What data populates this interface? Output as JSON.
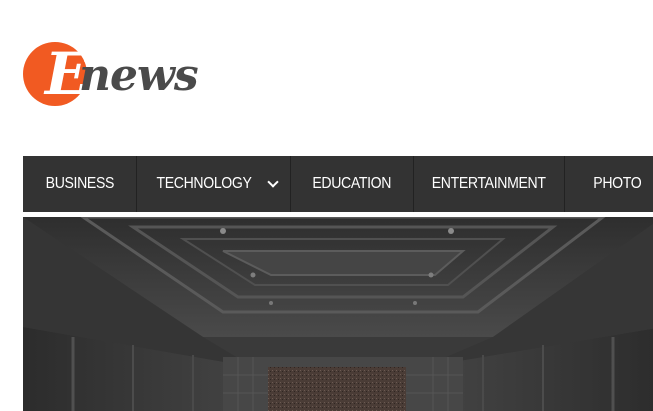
{
  "site": {
    "logo_initial": "E",
    "logo_rest": "news",
    "brand_color": "#f15a22"
  },
  "nav": {
    "items": [
      {
        "label": "BUSINESS",
        "has_dropdown": false
      },
      {
        "label": "TECHNOLOGY",
        "has_dropdown": true
      },
      {
        "label": "EDUCATION",
        "has_dropdown": false
      },
      {
        "label": "ENTERTAINMENT",
        "has_dropdown": false
      },
      {
        "label": "PHOTO",
        "has_dropdown": true
      }
    ],
    "background": "#333333"
  },
  "hero": {
    "icon": "corridor-photo"
  }
}
